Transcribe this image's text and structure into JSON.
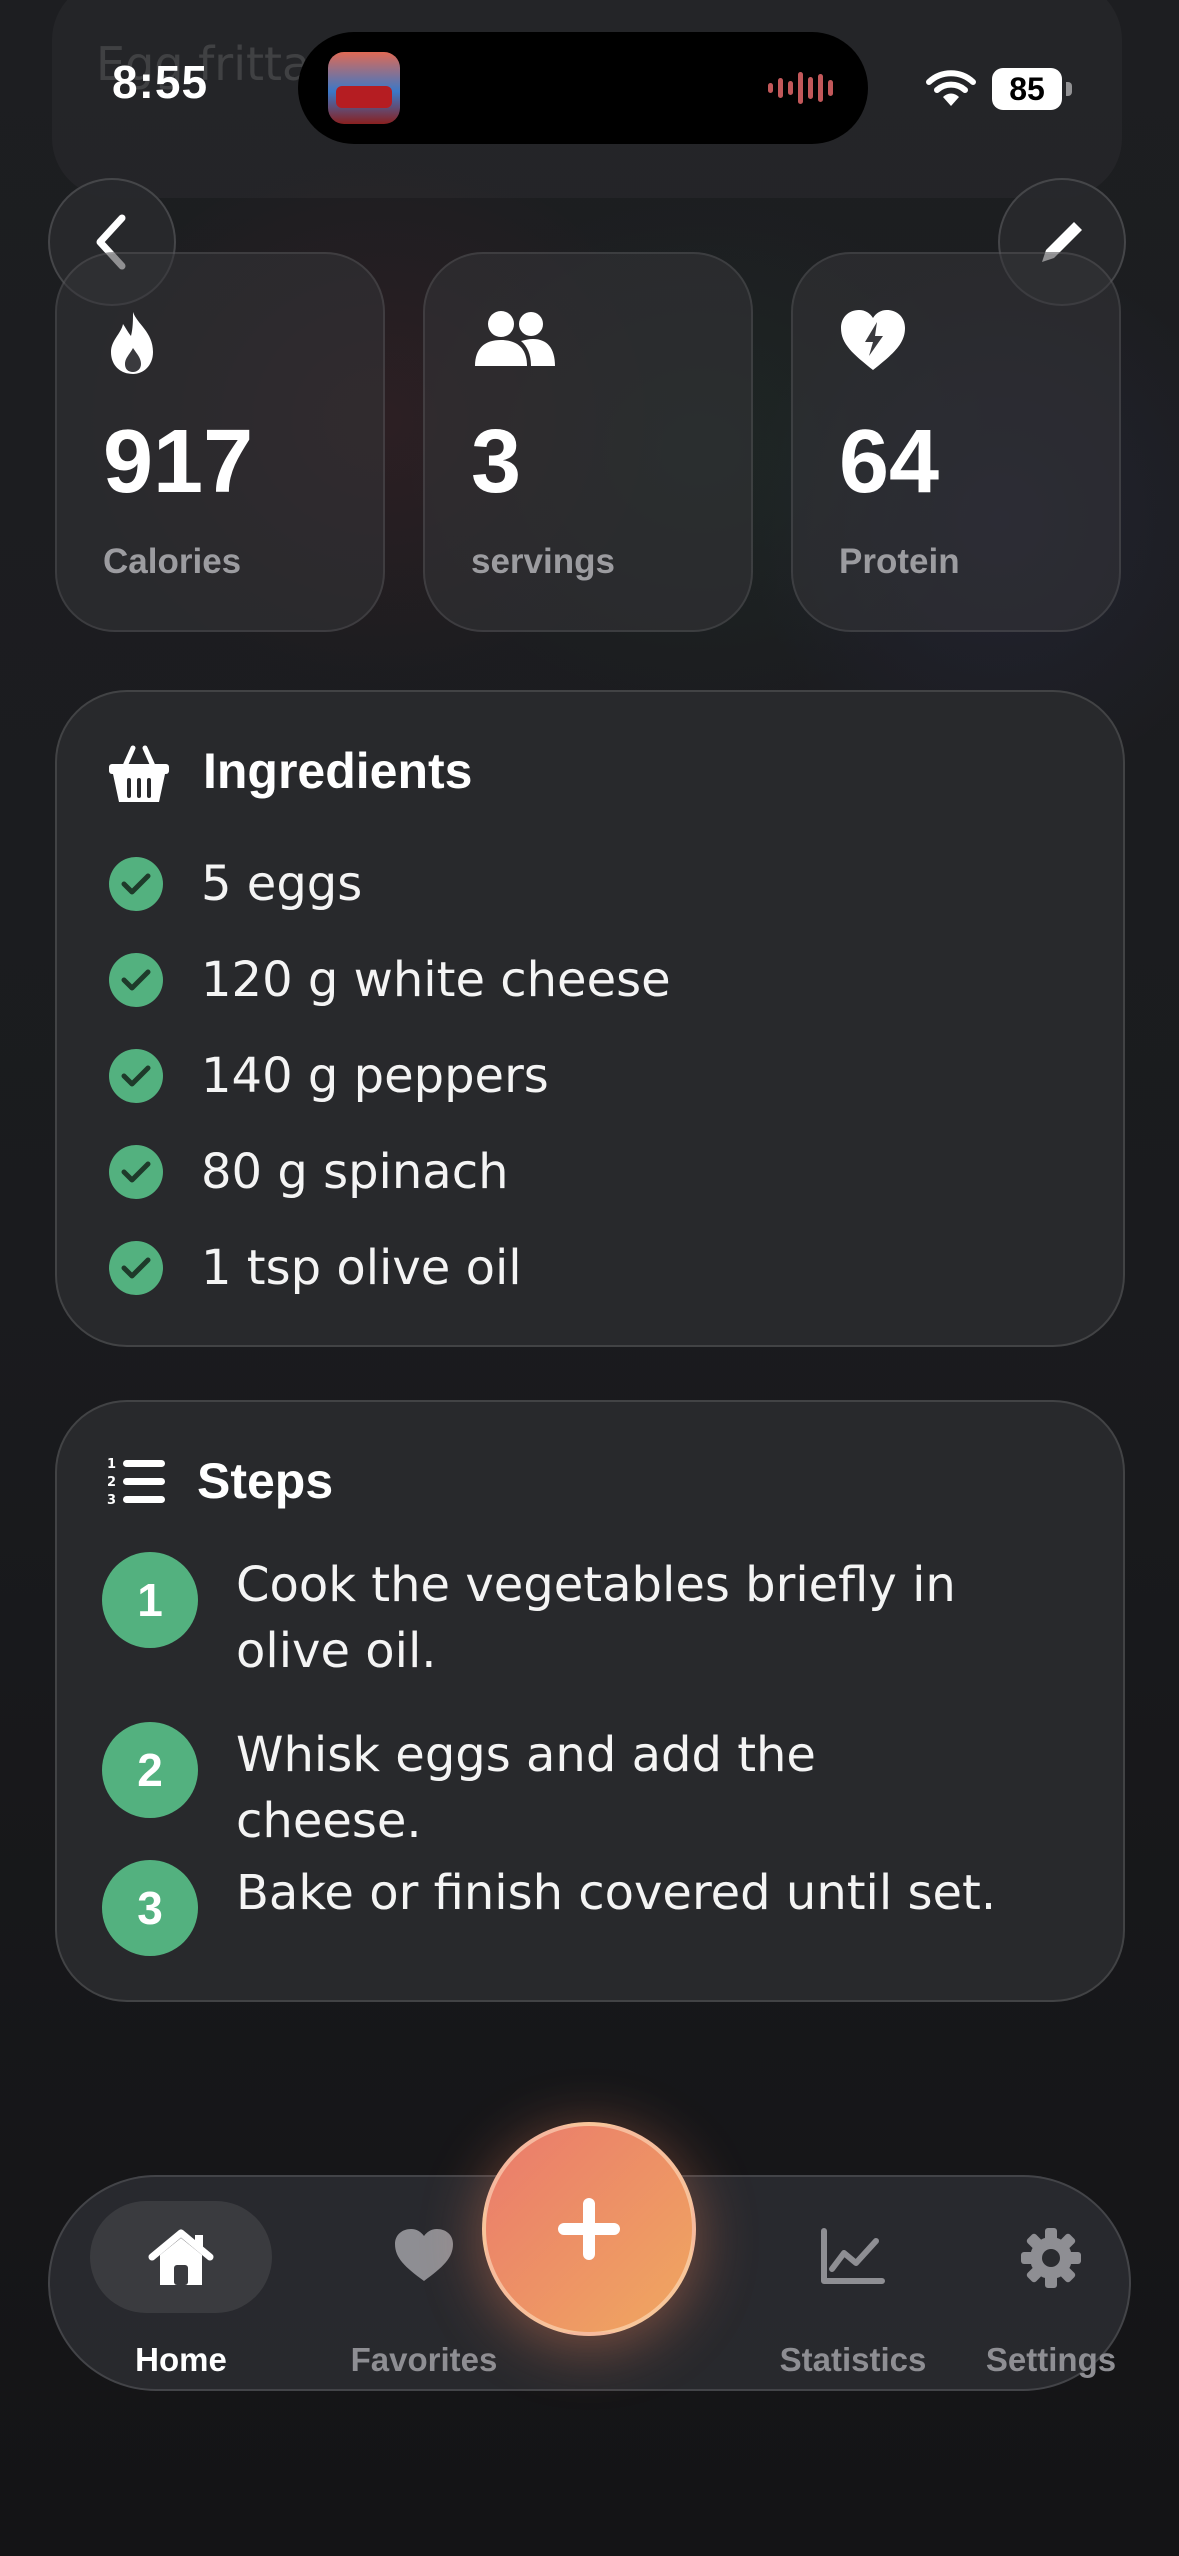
{
  "status_bar": {
    "time": "8:55",
    "battery": "85"
  },
  "recipe": {
    "title_partial": "Egg fritta white cheese"
  },
  "stats": [
    {
      "value": "917",
      "label": "Calories",
      "icon": "flame-icon"
    },
    {
      "value": "3",
      "label": "servings",
      "icon": "people-icon"
    },
    {
      "value": "64",
      "label": "Protein",
      "icon": "heart-bolt-icon"
    }
  ],
  "ingredients": {
    "title": "Ingredients",
    "items": [
      "5 eggs",
      "120 g white cheese",
      "140 g peppers",
      "80 g spinach",
      "1 tsp olive oil"
    ]
  },
  "steps": {
    "title": "Steps",
    "items": [
      {
        "num": "1",
        "text": "Cook the vegetables briefly in olive oil."
      },
      {
        "num": "2",
        "text": "Whisk eggs and add the cheese."
      },
      {
        "num": "3",
        "text": "Bake or finish covered until set."
      }
    ]
  },
  "tabbar": {
    "home": "Home",
    "favorites": "Favorites",
    "statistics": "Statistics",
    "settings": "Settings",
    "active": "Home"
  },
  "colors": {
    "accent_green": "#53b17f",
    "fab_orange": "#ee8f66",
    "background": "#17181b"
  }
}
